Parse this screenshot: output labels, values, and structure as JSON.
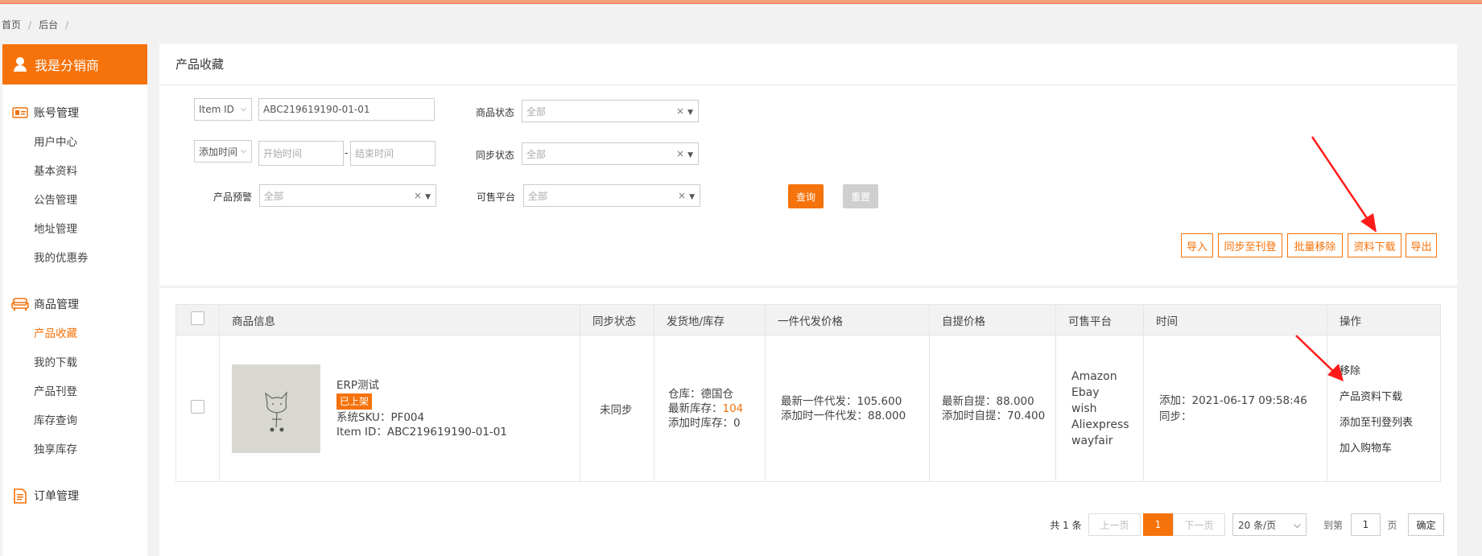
{
  "breadcrumb": {
    "home": "首页",
    "backend": "后台"
  },
  "sidebar": {
    "header": "我是分销商",
    "groups": [
      {
        "label": "账号管理",
        "items": [
          "用户中心",
          "基本资料",
          "公告管理",
          "地址管理",
          "我的优惠券"
        ]
      },
      {
        "label": "商品管理",
        "items": [
          "产品收藏",
          "我的下载",
          "产品刊登",
          "库存查询",
          "独享库存"
        ]
      },
      {
        "label": "订单管理",
        "items": []
      }
    ],
    "active_item": "产品收藏"
  },
  "panel": {
    "title": "产品收藏"
  },
  "filters": {
    "id_type": "Item ID",
    "id_value": "ABC219619190-01-01",
    "time_type": "添加时间",
    "start_placeholder": "开始时间",
    "end_placeholder": "结束时间",
    "range_dash": "-",
    "status_label": "商品状态",
    "status_value": "全部",
    "sync_label": "同步状态",
    "sync_value": "全部",
    "warn_label": "产品预警",
    "warn_value": "全部",
    "platform_label": "可售平台",
    "platform_value": "全部",
    "clear": "×",
    "caret": "▼",
    "query": "查询",
    "reset": "重置"
  },
  "actions": [
    "导入",
    "同步至刊登",
    "批量移除",
    "资料下载",
    "导出"
  ],
  "table": {
    "headers": [
      "商品信息",
      "同步状态",
      "发货地/库存",
      "一件代发价格",
      "自提价格",
      "可售平台",
      "时间",
      "操作"
    ],
    "row": {
      "name": "ERP测试",
      "badge": "已上架",
      "sku": "系统SKU：PF004",
      "item_id": "Item ID：ABC219619190-01-01",
      "sync": "未同步",
      "warehouse": "仓库：德国仓",
      "stock_label": "最新库存：",
      "stock_value": "104",
      "stock_added": "添加时库存：0",
      "dropship_latest": "最新一件代发：105.600",
      "dropship_added": "添加时一件代发：88.000",
      "pickup_latest": "最新自提：88.000",
      "pickup_added": "添加时自提：70.400",
      "platforms": [
        "Amazon",
        "Ebay",
        "wish",
        "Aliexpress",
        "wayfair"
      ],
      "time_added": "添加：2021-06-17 09:58:46",
      "time_sync": "同步：",
      "ops": [
        "移除",
        "产品资料下载",
        "添加至刊登列表",
        "加入购物车"
      ]
    }
  },
  "pager": {
    "total": "共 1 条",
    "prev": "上一页",
    "current": "1",
    "next": "下一页",
    "page_size": "20 条/页",
    "goto": "到第",
    "goto_value": "1",
    "page_unit": "页",
    "confirm": "确定"
  }
}
